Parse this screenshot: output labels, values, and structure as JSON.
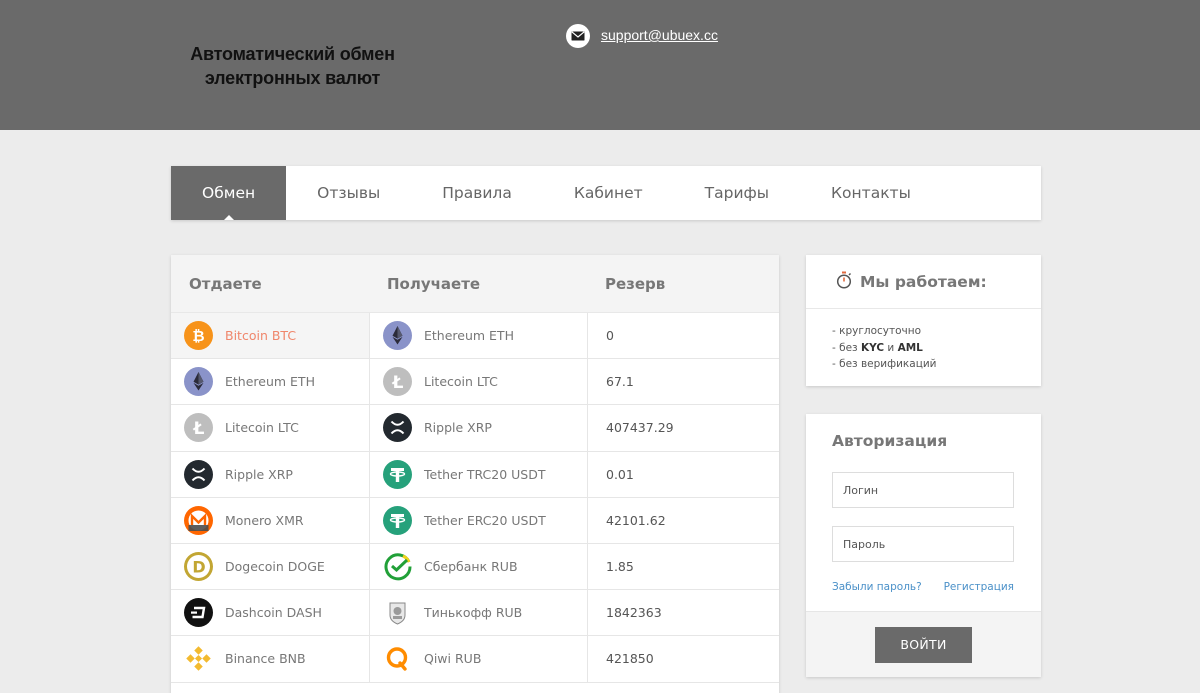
{
  "header": {
    "tagline_line1": "Автоматический обмен",
    "tagline_line2": "электронных валют",
    "support_email": "support@ubuex.cc"
  },
  "nav": {
    "items": [
      "Обмен",
      "Отзывы",
      "Правила",
      "Кабинет",
      "Тарифы",
      "Контакты"
    ],
    "active": "Обмен"
  },
  "exchange": {
    "headers": {
      "give": "Отдаете",
      "get": "Получаете",
      "reserve": "Резерв"
    },
    "rows": [
      {
        "give": "Bitcoin BTC",
        "give_icon": "bitcoin-icon",
        "get": "Ethereum ETH",
        "get_icon": "ethereum-icon",
        "reserve": "0"
      },
      {
        "give": "Ethereum ETH",
        "give_icon": "ethereum-icon",
        "get": "Litecoin LTC",
        "get_icon": "litecoin-icon",
        "reserve": "67.1"
      },
      {
        "give": "Litecoin LTC",
        "give_icon": "litecoin-icon",
        "get": "Ripple XRP",
        "get_icon": "ripple-icon",
        "reserve": "407437.29"
      },
      {
        "give": "Ripple XRP",
        "give_icon": "ripple-icon",
        "get": "Tether TRC20 USDT",
        "get_icon": "tether-icon",
        "reserve": "0.01"
      },
      {
        "give": "Monero XMR",
        "give_icon": "monero-icon",
        "get": "Tether ERC20 USDT",
        "get_icon": "tether-icon",
        "reserve": "42101.62"
      },
      {
        "give": "Dogecoin DOGE",
        "give_icon": "dogecoin-icon",
        "get": "Сбербанк RUB",
        "get_icon": "sberbank-icon",
        "reserve": "1.85"
      },
      {
        "give": "Dashcoin DASH",
        "give_icon": "dash-icon",
        "get": "Тинькофф RUB",
        "get_icon": "tinkoff-icon",
        "reserve": "1842363"
      },
      {
        "give": "Binance BNB",
        "give_icon": "binance-icon",
        "get": "Qiwi RUB",
        "get_icon": "qiwi-icon",
        "reserve": "421850"
      }
    ]
  },
  "work": {
    "title": "Мы работаем:",
    "line1": "- круглосуточно",
    "line2_prefix": "- без ",
    "line2_kyc": "KYC",
    "line2_and": " и ",
    "line2_aml": "AML",
    "line3": "- без верификаций"
  },
  "auth": {
    "title": "Авторизация",
    "login_placeholder": "Логин",
    "password_placeholder": "Пароль",
    "forgot_link": "Забыли пароль?",
    "register_link": "Регистрация",
    "submit": "ВОЙТИ"
  },
  "colors": {
    "header_bg": "#6a6a6a",
    "page_bg": "#ececec",
    "selected_text": "#f0866b",
    "link": "#4a90c8"
  }
}
